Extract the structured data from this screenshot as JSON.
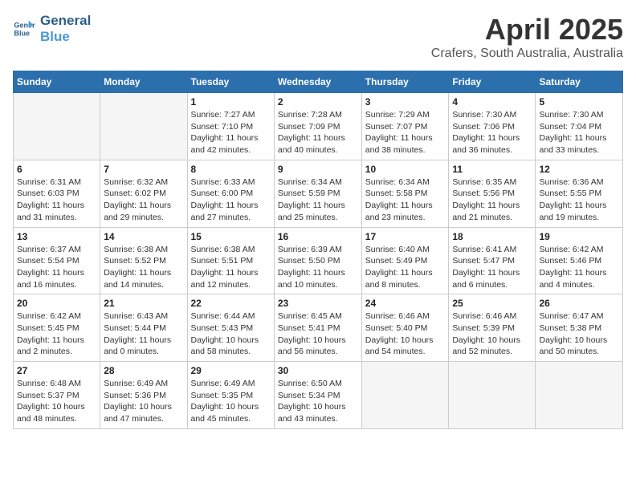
{
  "logo": {
    "line1": "General",
    "line2": "Blue"
  },
  "title": "April 2025",
  "subtitle": "Crafers, South Australia, Australia",
  "weekdays": [
    "Sunday",
    "Monday",
    "Tuesday",
    "Wednesday",
    "Thursday",
    "Friday",
    "Saturday"
  ],
  "weeks": [
    [
      {
        "day": "",
        "info": ""
      },
      {
        "day": "",
        "info": ""
      },
      {
        "day": "1",
        "info": "Sunrise: 7:27 AM\nSunset: 7:10 PM\nDaylight: 11 hours and 42 minutes."
      },
      {
        "day": "2",
        "info": "Sunrise: 7:28 AM\nSunset: 7:09 PM\nDaylight: 11 hours and 40 minutes."
      },
      {
        "day": "3",
        "info": "Sunrise: 7:29 AM\nSunset: 7:07 PM\nDaylight: 11 hours and 38 minutes."
      },
      {
        "day": "4",
        "info": "Sunrise: 7:30 AM\nSunset: 7:06 PM\nDaylight: 11 hours and 36 minutes."
      },
      {
        "day": "5",
        "info": "Sunrise: 7:30 AM\nSunset: 7:04 PM\nDaylight: 11 hours and 33 minutes."
      }
    ],
    [
      {
        "day": "6",
        "info": "Sunrise: 6:31 AM\nSunset: 6:03 PM\nDaylight: 11 hours and 31 minutes."
      },
      {
        "day": "7",
        "info": "Sunrise: 6:32 AM\nSunset: 6:02 PM\nDaylight: 11 hours and 29 minutes."
      },
      {
        "day": "8",
        "info": "Sunrise: 6:33 AM\nSunset: 6:00 PM\nDaylight: 11 hours and 27 minutes."
      },
      {
        "day": "9",
        "info": "Sunrise: 6:34 AM\nSunset: 5:59 PM\nDaylight: 11 hours and 25 minutes."
      },
      {
        "day": "10",
        "info": "Sunrise: 6:34 AM\nSunset: 5:58 PM\nDaylight: 11 hours and 23 minutes."
      },
      {
        "day": "11",
        "info": "Sunrise: 6:35 AM\nSunset: 5:56 PM\nDaylight: 11 hours and 21 minutes."
      },
      {
        "day": "12",
        "info": "Sunrise: 6:36 AM\nSunset: 5:55 PM\nDaylight: 11 hours and 19 minutes."
      }
    ],
    [
      {
        "day": "13",
        "info": "Sunrise: 6:37 AM\nSunset: 5:54 PM\nDaylight: 11 hours and 16 minutes."
      },
      {
        "day": "14",
        "info": "Sunrise: 6:38 AM\nSunset: 5:52 PM\nDaylight: 11 hours and 14 minutes."
      },
      {
        "day": "15",
        "info": "Sunrise: 6:38 AM\nSunset: 5:51 PM\nDaylight: 11 hours and 12 minutes."
      },
      {
        "day": "16",
        "info": "Sunrise: 6:39 AM\nSunset: 5:50 PM\nDaylight: 11 hours and 10 minutes."
      },
      {
        "day": "17",
        "info": "Sunrise: 6:40 AM\nSunset: 5:49 PM\nDaylight: 11 hours and 8 minutes."
      },
      {
        "day": "18",
        "info": "Sunrise: 6:41 AM\nSunset: 5:47 PM\nDaylight: 11 hours and 6 minutes."
      },
      {
        "day": "19",
        "info": "Sunrise: 6:42 AM\nSunset: 5:46 PM\nDaylight: 11 hours and 4 minutes."
      }
    ],
    [
      {
        "day": "20",
        "info": "Sunrise: 6:42 AM\nSunset: 5:45 PM\nDaylight: 11 hours and 2 minutes."
      },
      {
        "day": "21",
        "info": "Sunrise: 6:43 AM\nSunset: 5:44 PM\nDaylight: 11 hours and 0 minutes."
      },
      {
        "day": "22",
        "info": "Sunrise: 6:44 AM\nSunset: 5:43 PM\nDaylight: 10 hours and 58 minutes."
      },
      {
        "day": "23",
        "info": "Sunrise: 6:45 AM\nSunset: 5:41 PM\nDaylight: 10 hours and 56 minutes."
      },
      {
        "day": "24",
        "info": "Sunrise: 6:46 AM\nSunset: 5:40 PM\nDaylight: 10 hours and 54 minutes."
      },
      {
        "day": "25",
        "info": "Sunrise: 6:46 AM\nSunset: 5:39 PM\nDaylight: 10 hours and 52 minutes."
      },
      {
        "day": "26",
        "info": "Sunrise: 6:47 AM\nSunset: 5:38 PM\nDaylight: 10 hours and 50 minutes."
      }
    ],
    [
      {
        "day": "27",
        "info": "Sunrise: 6:48 AM\nSunset: 5:37 PM\nDaylight: 10 hours and 48 minutes."
      },
      {
        "day": "28",
        "info": "Sunrise: 6:49 AM\nSunset: 5:36 PM\nDaylight: 10 hours and 47 minutes."
      },
      {
        "day": "29",
        "info": "Sunrise: 6:49 AM\nSunset: 5:35 PM\nDaylight: 10 hours and 45 minutes."
      },
      {
        "day": "30",
        "info": "Sunrise: 6:50 AM\nSunset: 5:34 PM\nDaylight: 10 hours and 43 minutes."
      },
      {
        "day": "",
        "info": ""
      },
      {
        "day": "",
        "info": ""
      },
      {
        "day": "",
        "info": ""
      }
    ]
  ]
}
